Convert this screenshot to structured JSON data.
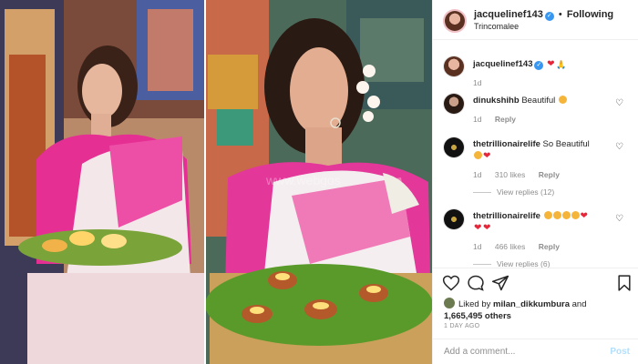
{
  "header": {
    "username": "jacquelinef143",
    "separator": "•",
    "follow_label": "Following",
    "location": "Trincomalee"
  },
  "photo": {
    "watermark": "www.webgos"
  },
  "caption": {
    "username": "jacquelinef143",
    "time": "1d"
  },
  "comments": [
    {
      "username": "dinukshihb",
      "text": "Beautiful",
      "time": "1d",
      "likes": "",
      "reply_label": "Reply",
      "replies": ""
    },
    {
      "username": "thetrillionairelife",
      "text": "So Beautiful",
      "time": "1d",
      "likes": "310 likes",
      "reply_label": "Reply",
      "replies": "View replies (12)"
    },
    {
      "username": "thetrillionairelife",
      "text": "",
      "time": "1d",
      "likes": "466 likes",
      "reply_label": "Reply",
      "replies": "View replies (6)"
    }
  ],
  "icons": [
    "heart-icon",
    "comment-icon",
    "share-icon",
    "bookmark-icon",
    "verified-icon"
  ],
  "likes": {
    "prefix": "Liked by",
    "user": "milan_dikkumbura",
    "and": "and",
    "count": "1,665,495 others"
  },
  "timestamp": "1 DAY AGO",
  "add_comment": {
    "placeholder": "Add a comment...",
    "post_label": "Post"
  },
  "colors": {
    "link_blue": "#3897f0",
    "meta_gray": "#8e8e8e",
    "post_disabled": "#b2dffc",
    "heart_red": "#e8263a"
  }
}
